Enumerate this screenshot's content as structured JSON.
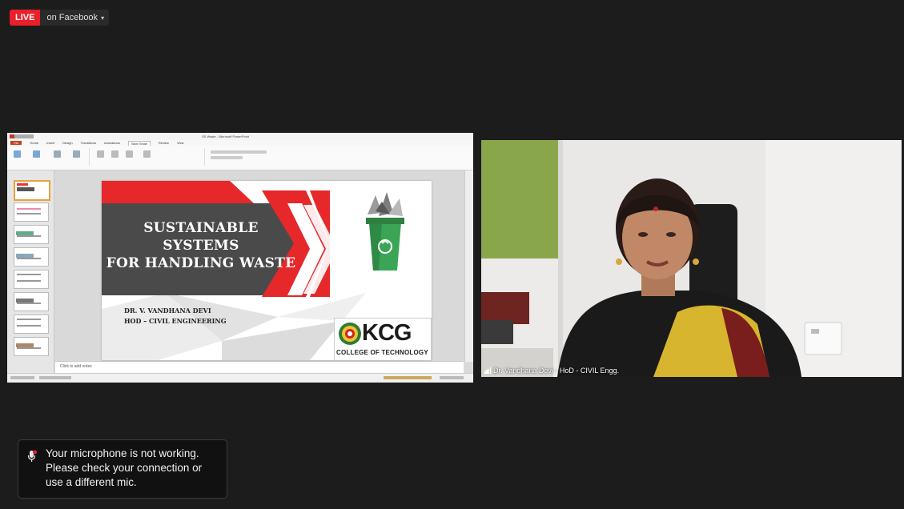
{
  "live": {
    "badge": "LIVE",
    "destination": "on Facebook",
    "caret": "▾"
  },
  "presentation": {
    "window_title": "SS Waste - Microsoft PowerPoint",
    "tabs": [
      "File",
      "Home",
      "Insert",
      "Design",
      "Transitions",
      "Animations",
      "Slide Show",
      "Review",
      "View"
    ],
    "active_tab": "Slide Show",
    "notes_placeholder": "Click to add notes",
    "slide": {
      "title_line1": "SUSTAINABLE SYSTEMS",
      "title_line2": "FOR HANDLING WASTE",
      "presenter_name": "DR. V. VANDHANA DEVI",
      "presenter_role": "HOD – CIVIL ENGINEERING",
      "logo_text": "KCG",
      "logo_subtext": "COLLEGE OF TECHNOLOGY"
    },
    "colors": {
      "slide_red": "#e6282b",
      "slide_dark": "#4a4a4a",
      "bin_green": "#3aa655"
    }
  },
  "camera": {
    "participant_name": "Dr. Vandhana Devi - HoD - CIVIL Engg.",
    "signal_icon": "signal-bars-icon"
  },
  "toast": {
    "icon": "microphone-warning-icon",
    "message_line1": "Your microphone is not working.",
    "message_line2": "Please check your connection or",
    "message_line3": "use a different mic."
  }
}
